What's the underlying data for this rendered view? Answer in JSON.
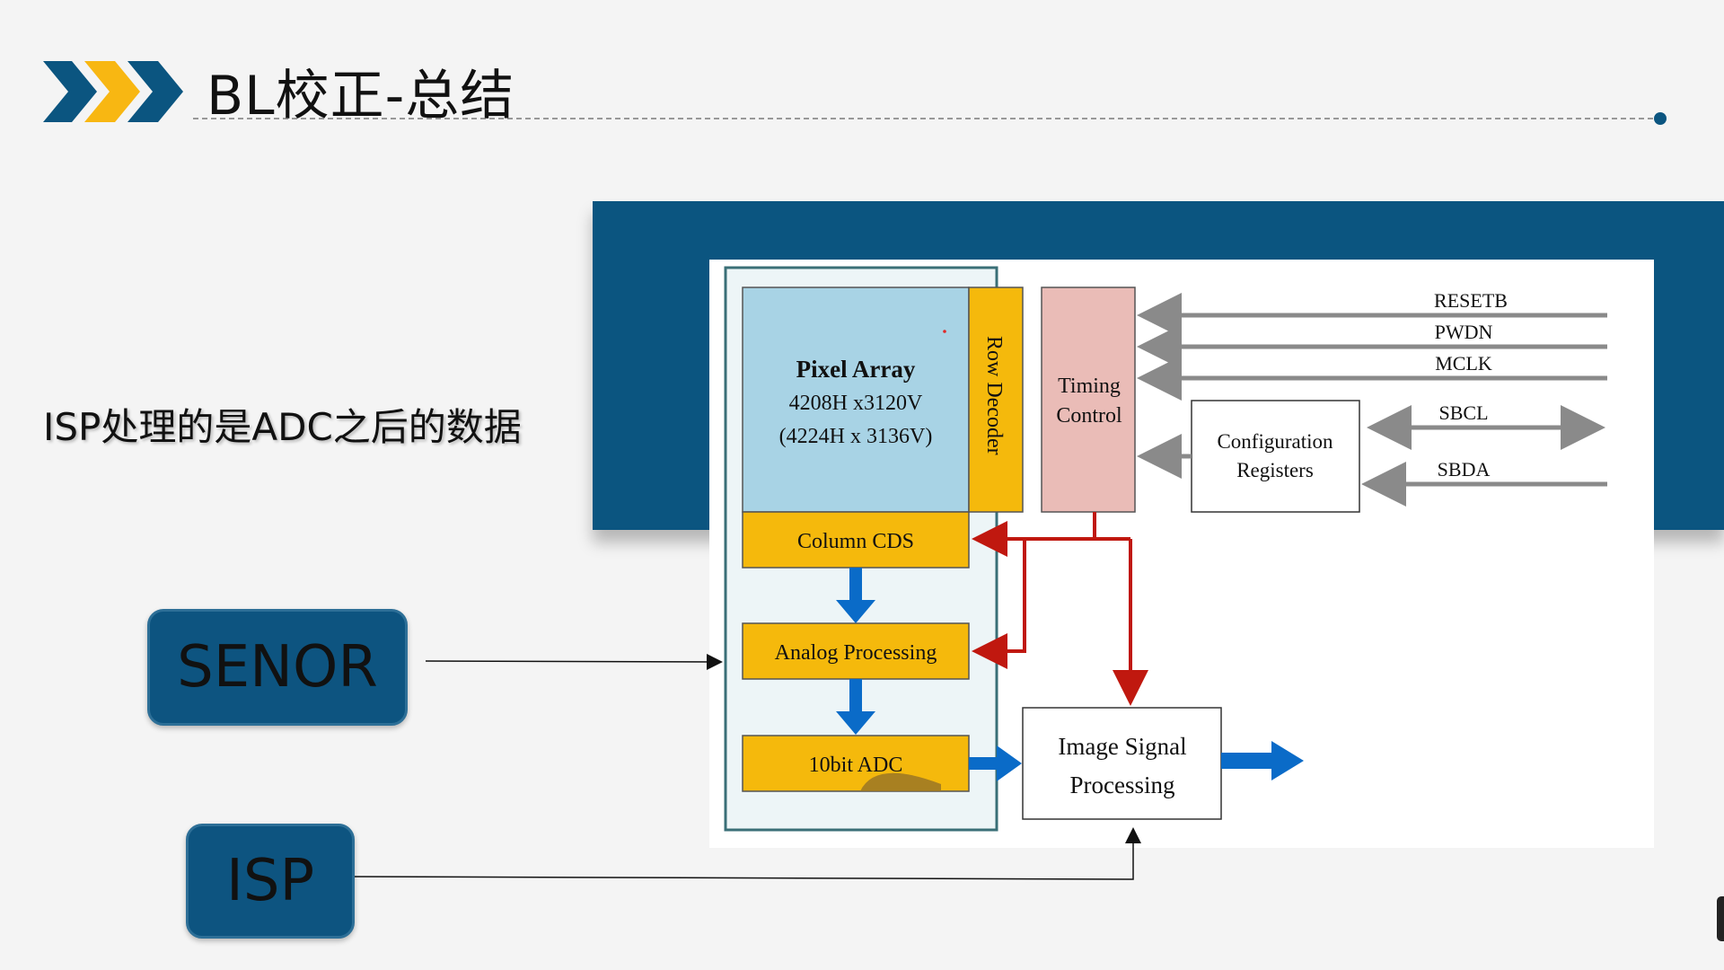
{
  "slide": {
    "title": "BL校正-总结",
    "subtitle": "ISP处理的是ADC之后的数据"
  },
  "boxes": {
    "senor": "SENOR",
    "isp": "ISP"
  },
  "diagram": {
    "pixel_array": {
      "title": "Pixel Array",
      "line1": "4208H x3120V",
      "line2": "(4224H x 3136V)"
    },
    "row_decoder": "Row Decoder",
    "column_cds": "Column CDS",
    "analog_processing": "Analog Processing",
    "adc": "10bit ADC",
    "timing_control": {
      "line1": "Timing",
      "line2": "Control"
    },
    "config_registers": {
      "line1": "Configuration",
      "line2": "Registers"
    },
    "image_signal_processing": {
      "line1": "Image Signal",
      "line2": "Processing"
    },
    "signals": [
      "RESETB",
      "PWDN",
      "MCLK",
      "SBCL",
      "SBDA"
    ]
  },
  "colors": {
    "accent_blue": "#0b5580",
    "accent_yellow": "#f8b712",
    "pixel_array": "#a8d3e5",
    "block_yellow": "#f5b90c",
    "timing_pink": "#eabcb7",
    "arrow_red": "#c0180f",
    "arrow_blue": "#0a6bc8"
  }
}
